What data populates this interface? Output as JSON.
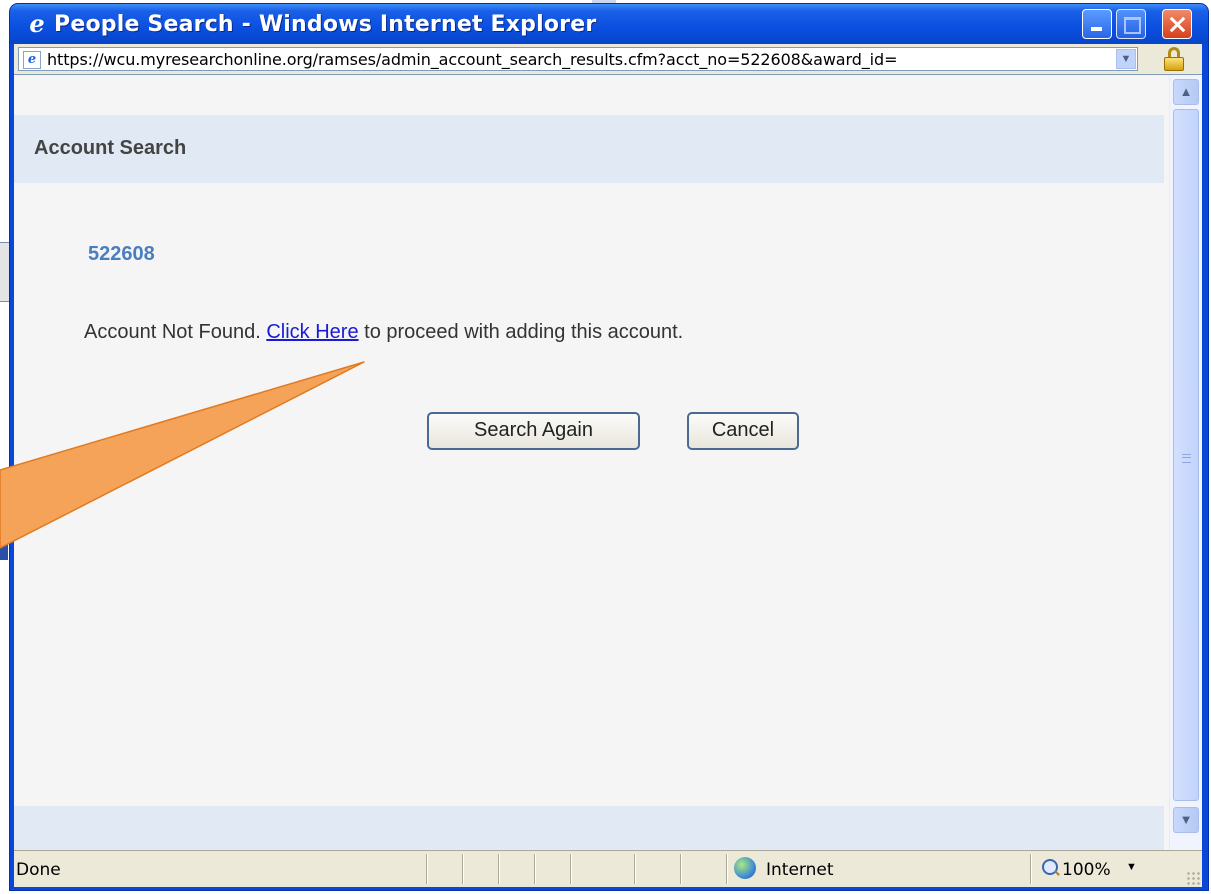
{
  "window": {
    "title": "People Search - Windows Internet Explorer",
    "ie_logo": "e"
  },
  "address": {
    "url": "https://wcu.myresearchonline.org/ramses/admin_account_search_results.cfm?acct_no=522608&award_id="
  },
  "header": {
    "title": "Account Search"
  },
  "result": {
    "account_number": "522608",
    "message_before": "Account Not Found. ",
    "link_text": "Click Here",
    "message_after": " to proceed with adding this account."
  },
  "buttons": {
    "search_again": "Search Again",
    "cancel": "Cancel"
  },
  "status": {
    "text": "Done",
    "zone": "Internet",
    "zoom": "100%"
  },
  "icons": [
    "ie-logo-icon",
    "page-icon",
    "lock-icon",
    "globe-icon",
    "zoom-icon",
    "minimize-icon",
    "maximize-icon",
    "close-icon"
  ],
  "colors": {
    "titlebar": "#0a4fe0",
    "callout": "#f6a35a",
    "link": "#1a1ad8",
    "account_number": "#4a7ebf",
    "header_band": "#e1eaf4"
  }
}
